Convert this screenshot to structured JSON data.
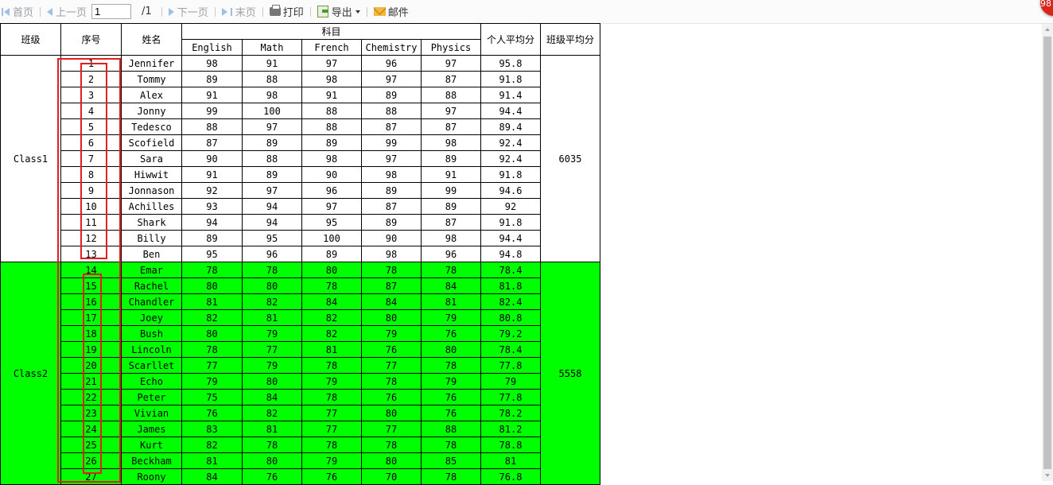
{
  "toolbar": {
    "first": "首页",
    "prev": "上一页",
    "page_value": "1",
    "total": "/1",
    "next": "下一页",
    "last": "末页",
    "print": "打印",
    "export": "导出",
    "mail": "邮件"
  },
  "badge": "98",
  "headers": {
    "class": "班级",
    "seq": "序号",
    "name": "姓名",
    "subjects": "科目",
    "english": "English",
    "math": "Math",
    "french": "French",
    "chemistry": "Chemistry",
    "physics": "Physics",
    "personal_avg": "个人平均分",
    "class_avg": "班级平均分"
  },
  "colors": {
    "class2_bg": "#00ff00",
    "highlight_box": "#e0201c"
  },
  "groups": [
    {
      "class": "Class1",
      "class_avg": "6035",
      "rows": [
        [
          "1",
          "Jennifer",
          "98",
          "91",
          "97",
          "96",
          "97",
          "95.8"
        ],
        [
          "2",
          "Tommy",
          "89",
          "88",
          "98",
          "97",
          "87",
          "91.8"
        ],
        [
          "3",
          "Alex",
          "91",
          "98",
          "91",
          "89",
          "88",
          "91.4"
        ],
        [
          "4",
          "Jonny",
          "99",
          "100",
          "88",
          "88",
          "97",
          "94.4"
        ],
        [
          "5",
          "Tedesco",
          "88",
          "97",
          "88",
          "87",
          "87",
          "89.4"
        ],
        [
          "6",
          "Scofield",
          "87",
          "89",
          "89",
          "99",
          "98",
          "92.4"
        ],
        [
          "7",
          "Sara",
          "90",
          "88",
          "98",
          "97",
          "89",
          "92.4"
        ],
        [
          "8",
          "Hiwwit",
          "91",
          "89",
          "90",
          "98",
          "91",
          "91.8"
        ],
        [
          "9",
          "Jonnason",
          "92",
          "97",
          "96",
          "89",
          "99",
          "94.6"
        ],
        [
          "10",
          "Achilles",
          "93",
          "94",
          "97",
          "87",
          "89",
          "92"
        ],
        [
          "11",
          "Shark",
          "94",
          "94",
          "95",
          "89",
          "87",
          "91.8"
        ],
        [
          "12",
          "Billy",
          "89",
          "95",
          "100",
          "90",
          "98",
          "94.4"
        ],
        [
          "13",
          "Ben",
          "95",
          "96",
          "89",
          "98",
          "96",
          "94.8"
        ]
      ]
    },
    {
      "class": "Class2",
      "class_avg": "5558",
      "rows": [
        [
          "14",
          "Emar",
          "78",
          "78",
          "80",
          "78",
          "78",
          "78.4"
        ],
        [
          "15",
          "Rachel",
          "80",
          "80",
          "78",
          "87",
          "84",
          "81.8"
        ],
        [
          "16",
          "Chandler",
          "81",
          "82",
          "84",
          "84",
          "81",
          "82.4"
        ],
        [
          "17",
          "Joey",
          "82",
          "81",
          "82",
          "80",
          "79",
          "80.8"
        ],
        [
          "18",
          "Bush",
          "80",
          "79",
          "82",
          "79",
          "76",
          "79.2"
        ],
        [
          "19",
          "Lincoln",
          "78",
          "77",
          "81",
          "76",
          "80",
          "78.4"
        ],
        [
          "20",
          "Scarllet",
          "77",
          "79",
          "78",
          "77",
          "78",
          "77.8"
        ],
        [
          "21",
          "Echo",
          "79",
          "80",
          "79",
          "78",
          "79",
          "79"
        ],
        [
          "22",
          "Peter",
          "75",
          "84",
          "78",
          "76",
          "76",
          "77.8"
        ],
        [
          "23",
          "Vivian",
          "76",
          "82",
          "77",
          "80",
          "76",
          "78.2"
        ],
        [
          "24",
          "James",
          "83",
          "81",
          "77",
          "77",
          "88",
          "81.2"
        ],
        [
          "25",
          "Kurt",
          "82",
          "78",
          "78",
          "78",
          "78",
          "78.8"
        ],
        [
          "26",
          "Beckham",
          "81",
          "80",
          "79",
          "80",
          "85",
          "81"
        ],
        [
          "27",
          "Roony",
          "84",
          "76",
          "76",
          "70",
          "78",
          "76.8"
        ]
      ]
    }
  ]
}
